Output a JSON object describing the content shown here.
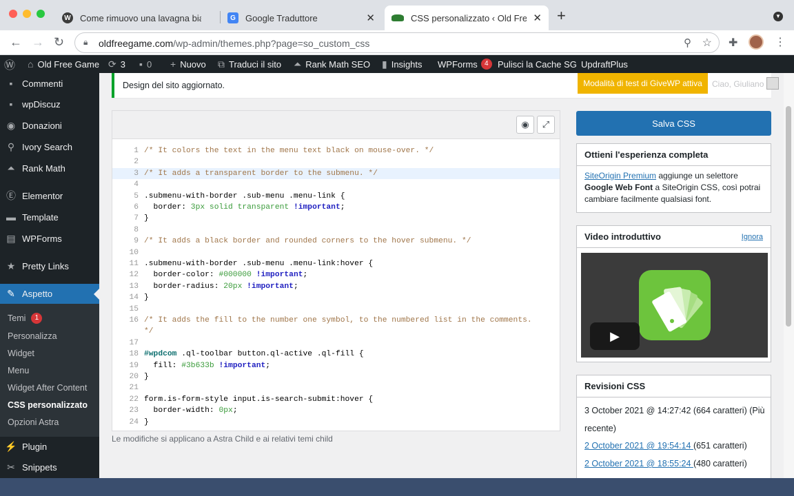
{
  "browser": {
    "tabs": [
      {
        "title": "Come rimuovo una lavagna bia",
        "icon": "wordpress-icon",
        "active": false
      },
      {
        "title": "Google Traduttore",
        "icon": "google-translate-icon",
        "active": false
      },
      {
        "title": "CSS personalizzato ‹ Old Free",
        "icon": "turtle-icon",
        "active": true
      }
    ],
    "url_host": "oldfreegame.com",
    "url_path": "/wp-admin/themes.php?page=so_custom_css"
  },
  "adminbar": {
    "site": "Old Free Game",
    "updates": "3",
    "comments": "0",
    "new": "Nuovo",
    "translate": "Traduci il sito",
    "rankmath": "Rank Math SEO",
    "insights": "Insights",
    "wpforms": "WPForms",
    "wpforms_badge": "4",
    "cache": "Pulisci la Cache SG",
    "updraft": "UpdraftPlus"
  },
  "sidebar": {
    "items": [
      {
        "label": "Commenti",
        "icon": "comment-icon"
      },
      {
        "label": "wpDiscuz",
        "icon": "discuss-icon"
      },
      {
        "label": "Donazioni",
        "icon": "donation-icon"
      },
      {
        "label": "Ivory Search",
        "icon": "search-icon"
      },
      {
        "label": "Rank Math",
        "icon": "chart-icon"
      },
      {
        "label": "Elementor",
        "icon": "elementor-icon"
      },
      {
        "label": "Template",
        "icon": "folder-icon"
      },
      {
        "label": "WPForms",
        "icon": "form-icon"
      },
      {
        "label": "Pretty Links",
        "icon": "star-link-icon"
      },
      {
        "label": "Aspetto",
        "icon": "brush-icon"
      },
      {
        "label": "Plugin",
        "icon": "plugin-icon"
      },
      {
        "label": "Snippets",
        "icon": "scissors-icon"
      }
    ],
    "submenu": [
      {
        "label": "Temi",
        "badge": "1"
      },
      {
        "label": "Personalizza"
      },
      {
        "label": "Widget"
      },
      {
        "label": "Menu"
      },
      {
        "label": "Widget After Content"
      },
      {
        "label": "CSS personalizzato"
      },
      {
        "label": "Opzioni Astra"
      }
    ]
  },
  "notice": {
    "message": "Design del sito aggiornato.",
    "givewp": "Modalità di test di GiveWP attiva",
    "greeting": "Ciao, Giuliano"
  },
  "editor": {
    "footer": "Le modifiche si applicano a Astra Child e ai relativi temi child",
    "lines": [
      {
        "n": "1",
        "segs": [
          [
            "cm",
            "/* It colors the text in the menu text black on mouse-over. */"
          ]
        ]
      },
      {
        "n": "2",
        "segs": []
      },
      {
        "n": "3",
        "segs": [
          [
            "cm",
            "/* It adds a transparent border to the submenu. */"
          ]
        ]
      },
      {
        "n": "4",
        "segs": []
      },
      {
        "n": "5",
        "segs": [
          [
            "",
            ".submenu-with-border .sub-menu .menu-link {"
          ]
        ]
      },
      {
        "n": "6",
        "segs": [
          [
            "",
            "  border: "
          ],
          [
            "num",
            "3px"
          ],
          [
            "",
            " "
          ],
          [
            "num",
            "solid transparent"
          ],
          [
            "",
            " "
          ],
          [
            "kw",
            "!important"
          ],
          [
            "",
            ";"
          ]
        ]
      },
      {
        "n": "7",
        "segs": [
          [
            "",
            "}"
          ]
        ]
      },
      {
        "n": "8",
        "segs": []
      },
      {
        "n": "9",
        "segs": [
          [
            "cm",
            "/* It adds a black border and rounded corners to the hover submenu. */"
          ]
        ]
      },
      {
        "n": "10",
        "segs": []
      },
      {
        "n": "11",
        "segs": [
          [
            "",
            ".submenu-with-border .sub-menu .menu-link:hover {"
          ]
        ]
      },
      {
        "n": "12",
        "segs": [
          [
            "",
            "  border-color: "
          ],
          [
            "num",
            "#000000"
          ],
          [
            "",
            " "
          ],
          [
            "kw",
            "!important"
          ],
          [
            "",
            ";"
          ]
        ]
      },
      {
        "n": "13",
        "segs": [
          [
            "",
            "  border-radius: "
          ],
          [
            "num",
            "20px"
          ],
          [
            "",
            " "
          ],
          [
            "kw",
            "!important"
          ],
          [
            "",
            ";"
          ]
        ]
      },
      {
        "n": "14",
        "segs": [
          [
            "",
            "}"
          ]
        ]
      },
      {
        "n": "15",
        "segs": []
      },
      {
        "n": "16",
        "segs": [
          [
            "cm",
            "/* It adds the fill to the number one symbol, to the numbered list in the comments."
          ]
        ]
      },
      {
        "n": "",
        "segs": [
          [
            "cm",
            "*/"
          ]
        ]
      },
      {
        "n": "17",
        "segs": []
      },
      {
        "n": "18",
        "segs": [
          [
            "idc",
            "#wpdcom"
          ],
          [
            "",
            " .ql-toolbar button.ql-active .ql-fill {"
          ]
        ]
      },
      {
        "n": "19",
        "segs": [
          [
            "",
            "  fill: "
          ],
          [
            "num",
            "#3b633b"
          ],
          [
            "",
            " "
          ],
          [
            "kw",
            "!important"
          ],
          [
            "",
            ";"
          ]
        ]
      },
      {
        "n": "20",
        "segs": [
          [
            "",
            "}"
          ]
        ]
      },
      {
        "n": "21",
        "segs": []
      },
      {
        "n": "22",
        "segs": [
          [
            "",
            "form.is-form-style input.is-search-submit:hover {"
          ]
        ]
      },
      {
        "n": "23",
        "segs": [
          [
            "",
            "  border-width: "
          ],
          [
            "num",
            "0px"
          ],
          [
            "",
            ";"
          ]
        ]
      },
      {
        "n": "24",
        "segs": [
          [
            "",
            "}"
          ]
        ]
      }
    ]
  },
  "right": {
    "save": "Salva CSS",
    "premium_title": "Ottieni l'esperienza completa",
    "premium_link": "SiteOrigin Premium",
    "premium_text1": " aggiunge un selettore ",
    "premium_bold": "Google Web Font",
    "premium_text2": " a SiteOrigin CSS, così potrai cambiare facilmente qualsiasi font.",
    "video_title": "Video introduttivo",
    "video_ignore": "Ignora",
    "revisions_title": "Revisioni CSS",
    "rev1_a": "3 October 2021 @ 14:27:42 (664 caratteri) (Più",
    "rev1_b": "recente)",
    "rev2_link": "2 October 2021 @ 19:54:14 ",
    "rev2_text": "(651 caratteri)",
    "rev3_link": "2 October 2021 @ 18:55:24 ",
    "rev3_text": "(480 caratteri)"
  },
  "colors": {
    "accent": "#2271b1",
    "adminbar": "#1d2327",
    "givewp": "#f0b400",
    "notice": "#00a32a"
  }
}
